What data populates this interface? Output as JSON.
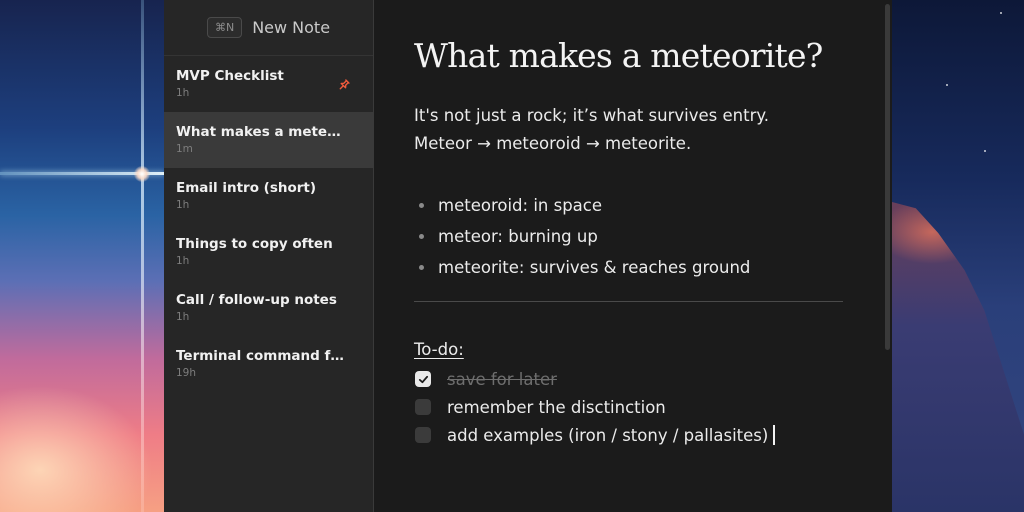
{
  "sidebar": {
    "new_note": {
      "shortcut": "⌘N",
      "label": "New Note"
    },
    "notes": [
      {
        "title": "MVP Checklist",
        "time": "1h",
        "pinned": true,
        "active": false
      },
      {
        "title": "What makes a meteorite?",
        "time": "1m",
        "pinned": false,
        "active": true
      },
      {
        "title": "Email intro (short)",
        "time": "1h",
        "pinned": false,
        "active": false
      },
      {
        "title": "Things to copy often",
        "time": "1h",
        "pinned": false,
        "active": false
      },
      {
        "title": "Call / follow-up notes",
        "time": "1h",
        "pinned": false,
        "active": false
      },
      {
        "title": "Terminal command for c...",
        "time": "19h",
        "pinned": false,
        "active": false
      }
    ]
  },
  "editor": {
    "title": "What makes a meteorite?",
    "paragraphs": [
      "It's not just a rock; it’s what survives entry.",
      "Meteor → meteoroid → meteorite."
    ],
    "bullets": [
      "meteoroid: in space",
      "meteor: burning up",
      "meteorite: survives & reaches ground"
    ],
    "todo_label": "To-do:",
    "todos": [
      {
        "text": "save for later",
        "checked": true
      },
      {
        "text": "remember the disctinction",
        "checked": false
      },
      {
        "text": "add examples (iron / stony / pallasites)",
        "checked": false
      }
    ]
  },
  "colors": {
    "pin_accent": "#ef5a3c",
    "editor_background": "#1b1b1b",
    "sidebar_background": "#262626",
    "active_note_background": "#3a3a3a"
  },
  "icons": {
    "pin": "pin-icon",
    "checkmark": "checkmark-icon"
  }
}
